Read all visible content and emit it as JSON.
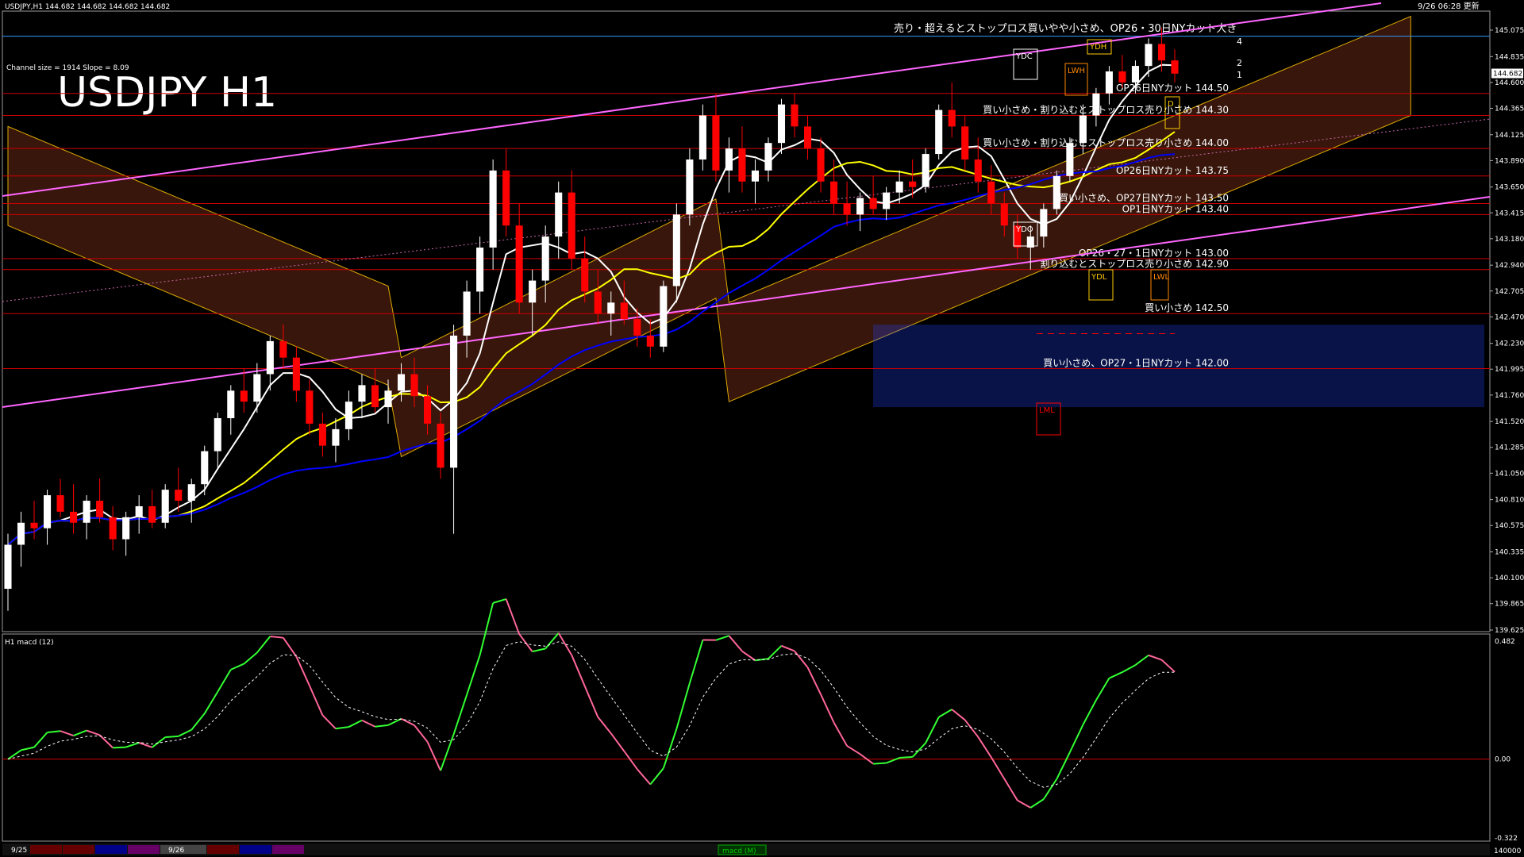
{
  "header": {
    "symbol_line": "USDJPY,H1  144.682  144.682  144.682  144.682",
    "datetime": "9/26 06:28 更新",
    "channel_info": "Channel size = 1914  Slope = 8.09",
    "big_title": "USDJPY H1",
    "top_annotation": "売り・超えるとストップロス買いやや小さめ、OP26・30日NYカット大き"
  },
  "colors": {
    "background": "#000000",
    "up_candle": "#ffffff",
    "down_candle": "#ff0000",
    "ma_fast": "#ffffff",
    "ma_mid": "#ffff00",
    "ma_slow": "#0000ff",
    "channel": "#ff66ff",
    "cloud_up": "#ff6633",
    "cloud_down": "#2244ff",
    "level_line": "#cc0000",
    "macd_up": "#33ff33",
    "macd_down": "#ff6699"
  },
  "price_axis": {
    "ticks": [
      "145.075",
      "144.835",
      "144.600",
      "144.365",
      "144.125",
      "143.890",
      "143.650",
      "143.415",
      "143.180",
      "142.940",
      "142.705",
      "142.470",
      "142.230",
      "141.995",
      "141.760",
      "141.520",
      "141.285",
      "141.050",
      "140.810",
      "140.575",
      "140.335",
      "140.100",
      "139.865",
      "139.625"
    ],
    "current_price": "144.682"
  },
  "levels": [
    {
      "price": 144.5,
      "label": "OP26日NYカット 144.50"
    },
    {
      "price": 144.3,
      "label": "買い小さめ・割り込むとストップロス売り小さめ 144.30"
    },
    {
      "price": 144.0,
      "label": "買い小さめ・割り込むとストップロス売り小さめ 144.00"
    },
    {
      "price": 143.75,
      "label": "OP26日NYカット 143.75"
    },
    {
      "price": 143.5,
      "label": "買い小さめ、OP27日NYカット 143.50"
    },
    {
      "price": 143.4,
      "label": "OP1日NYカット 143.40"
    },
    {
      "price": 143.0,
      "label": "OP26・27・1日NYカット 143.00"
    },
    {
      "price": 142.9,
      "label": "割り込むとストップロス売り小さめ 142.90"
    },
    {
      "price": 142.5,
      "label": "買い小さめ 142.50"
    },
    {
      "price": 142.0,
      "label": "買い小さめ、OP27・1日NYカット 142.00"
    }
  ],
  "markers": {
    "ydc": "YDC",
    "ydh": "YDH",
    "ydo": "YDO",
    "ydl": "YDL",
    "lwh": "LWH",
    "lwl": "LWL",
    "lml": "LML",
    "d": "D",
    "fib_labels": [
      "4",
      "2",
      "1"
    ]
  },
  "macd_panel": {
    "title": "H1 macd (12)",
    "ticks": [
      "0.482",
      "0.00",
      "-0.322"
    ]
  },
  "footer": {
    "date1": "9/25",
    "date2": "9/26",
    "center_label": "macd (M)",
    "right_value": "140000"
  },
  "chart_data": {
    "type": "candlestick",
    "title": "USDJPY H1",
    "ylim": [
      139.625,
      145.075
    ],
    "ohlc": [
      [
        140.0,
        140.5,
        139.8,
        140.4
      ],
      [
        140.4,
        140.7,
        140.2,
        140.6
      ],
      [
        140.6,
        140.8,
        140.45,
        140.55
      ],
      [
        140.55,
        140.9,
        140.4,
        140.85
      ],
      [
        140.85,
        141.0,
        140.65,
        140.7
      ],
      [
        140.7,
        140.95,
        140.5,
        140.6
      ],
      [
        140.6,
        140.85,
        140.45,
        140.8
      ],
      [
        140.8,
        141.0,
        140.6,
        140.65
      ],
      [
        140.65,
        140.75,
        140.35,
        140.45
      ],
      [
        140.45,
        140.7,
        140.3,
        140.65
      ],
      [
        140.65,
        140.85,
        140.5,
        140.75
      ],
      [
        140.75,
        140.9,
        140.55,
        140.6
      ],
      [
        140.6,
        140.95,
        140.55,
        140.9
      ],
      [
        140.9,
        141.1,
        140.7,
        140.8
      ],
      [
        140.8,
        141.0,
        140.6,
        140.95
      ],
      [
        140.95,
        141.3,
        140.85,
        141.25
      ],
      [
        141.25,
        141.6,
        141.1,
        141.55
      ],
      [
        141.55,
        141.85,
        141.4,
        141.8
      ],
      [
        141.8,
        142.0,
        141.6,
        141.7
      ],
      [
        141.7,
        142.05,
        141.6,
        141.95
      ],
      [
        141.95,
        142.3,
        141.8,
        142.25
      ],
      [
        142.25,
        142.4,
        142.0,
        142.1
      ],
      [
        142.1,
        142.2,
        141.7,
        141.8
      ],
      [
        141.8,
        141.9,
        141.4,
        141.5
      ],
      [
        141.5,
        141.6,
        141.2,
        141.3
      ],
      [
        141.3,
        141.55,
        141.15,
        141.45
      ],
      [
        141.45,
        141.8,
        141.35,
        141.7
      ],
      [
        141.7,
        141.95,
        141.55,
        141.85
      ],
      [
        141.85,
        142.0,
        141.6,
        141.65
      ],
      [
        141.65,
        141.9,
        141.5,
        141.8
      ],
      [
        141.8,
        142.05,
        141.7,
        141.95
      ],
      [
        141.95,
        142.1,
        141.65,
        141.75
      ],
      [
        141.75,
        141.85,
        141.4,
        141.5
      ],
      [
        141.5,
        141.6,
        141.0,
        141.1
      ],
      [
        141.1,
        142.4,
        140.5,
        142.3
      ],
      [
        142.3,
        142.8,
        142.1,
        142.7
      ],
      [
        142.7,
        143.2,
        142.5,
        143.1
      ],
      [
        143.1,
        143.9,
        142.9,
        143.8
      ],
      [
        143.8,
        144.0,
        143.2,
        143.3
      ],
      [
        143.3,
        143.5,
        142.5,
        142.6
      ],
      [
        142.6,
        142.9,
        142.3,
        142.8
      ],
      [
        142.8,
        143.3,
        142.6,
        143.2
      ],
      [
        143.2,
        143.7,
        143.0,
        143.6
      ],
      [
        143.6,
        143.8,
        142.9,
        143.0
      ],
      [
        143.0,
        143.2,
        142.6,
        142.7
      ],
      [
        142.7,
        142.9,
        142.4,
        142.5
      ],
      [
        142.5,
        142.7,
        142.3,
        142.6
      ],
      [
        142.6,
        142.8,
        142.4,
        142.45
      ],
      [
        142.45,
        142.55,
        142.2,
        142.3
      ],
      [
        142.3,
        142.45,
        142.1,
        142.2
      ],
      [
        142.2,
        142.8,
        142.15,
        142.75
      ],
      [
        142.75,
        143.5,
        142.6,
        143.4
      ],
      [
        143.4,
        144.0,
        143.3,
        143.9
      ],
      [
        143.9,
        144.4,
        143.8,
        144.3
      ],
      [
        144.3,
        144.5,
        143.7,
        143.8
      ],
      [
        143.8,
        144.1,
        143.6,
        144.0
      ],
      [
        144.0,
        144.2,
        143.6,
        143.7
      ],
      [
        143.7,
        143.9,
        143.5,
        143.8
      ],
      [
        143.8,
        144.1,
        143.7,
        144.05
      ],
      [
        144.05,
        144.45,
        143.95,
        144.4
      ],
      [
        144.4,
        144.5,
        144.1,
        144.2
      ],
      [
        144.2,
        144.3,
        143.9,
        144.0
      ],
      [
        144.0,
        144.1,
        143.6,
        143.7
      ],
      [
        143.7,
        143.9,
        143.4,
        143.5
      ],
      [
        143.5,
        143.7,
        143.3,
        143.4
      ],
      [
        143.4,
        143.6,
        143.25,
        143.55
      ],
      [
        143.55,
        143.75,
        143.4,
        143.45
      ],
      [
        143.45,
        143.65,
        143.35,
        143.6
      ],
      [
        143.6,
        143.8,
        143.5,
        143.7
      ],
      [
        143.7,
        143.9,
        143.55,
        143.65
      ],
      [
        143.65,
        144.0,
        143.6,
        143.95
      ],
      [
        143.95,
        144.4,
        143.9,
        144.35
      ],
      [
        144.35,
        144.6,
        144.1,
        144.2
      ],
      [
        144.2,
        144.3,
        143.8,
        143.9
      ],
      [
        143.9,
        144.1,
        143.6,
        143.7
      ],
      [
        143.7,
        143.85,
        143.4,
        143.5
      ],
      [
        143.5,
        143.6,
        143.2,
        143.3
      ],
      [
        143.3,
        143.4,
        143.0,
        143.1
      ],
      [
        143.1,
        143.3,
        142.9,
        143.2
      ],
      [
        143.2,
        143.5,
        143.1,
        143.45
      ],
      [
        143.45,
        143.8,
        143.4,
        143.75
      ],
      [
        143.75,
        144.1,
        143.7,
        144.05
      ],
      [
        144.05,
        144.4,
        143.95,
        144.3
      ],
      [
        144.3,
        144.55,
        144.2,
        144.5
      ],
      [
        144.5,
        144.75,
        144.4,
        144.7
      ],
      [
        144.7,
        144.85,
        144.55,
        144.6
      ],
      [
        144.6,
        144.8,
        144.5,
        144.75
      ],
      [
        144.75,
        145.0,
        144.65,
        144.95
      ],
      [
        144.95,
        145.1,
        144.7,
        144.8
      ],
      [
        144.8,
        144.9,
        144.6,
        144.68
      ]
    ]
  }
}
